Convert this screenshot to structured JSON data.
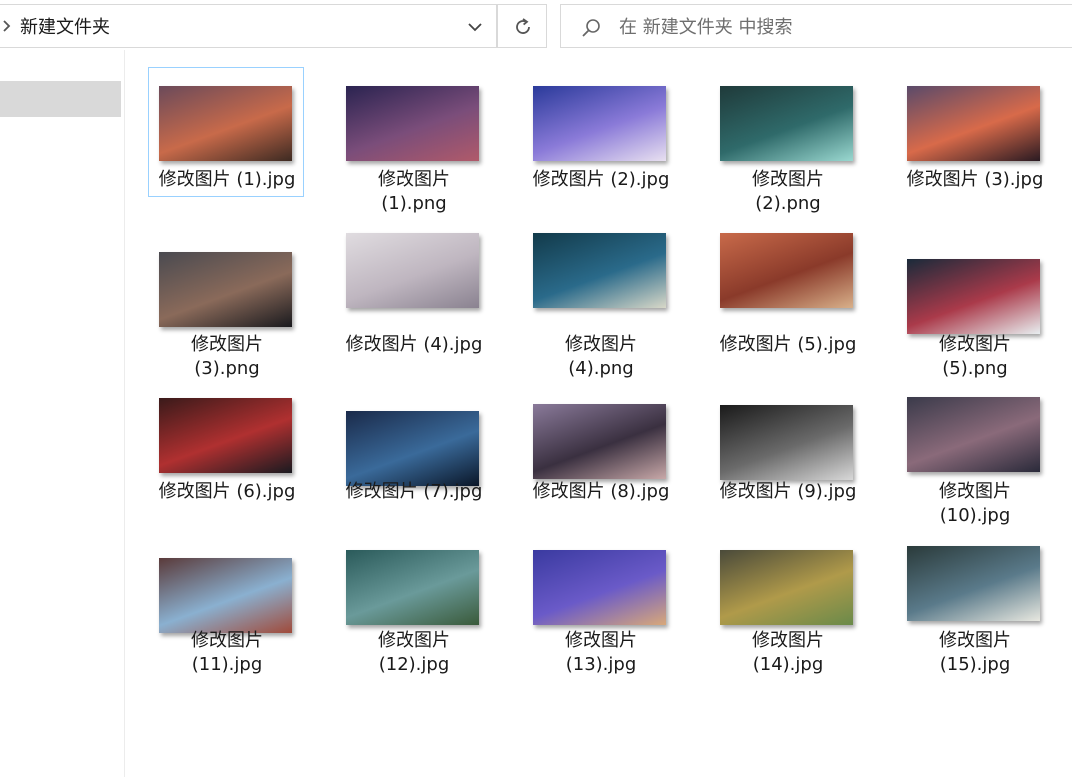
{
  "toolbar": {
    "address_text": "新建文件夹",
    "search_placeholder": "在 新建文件夹 中搜索"
  },
  "icons": {
    "address_chevron": "chevron-right-icon",
    "address_dropdown": "chevron-down-icon",
    "refresh": "refresh-icon",
    "search": "search-icon"
  },
  "files": [
    {
      "name": "修改图片 (1).jpg",
      "selected": true,
      "colors": [
        "#6b4a5a",
        "#c86a4a",
        "#3d2a22"
      ]
    },
    {
      "name": "修改图片\n(1).png",
      "selected": false,
      "colors": [
        "#2a2350",
        "#7a4d7a",
        "#b05a6a"
      ]
    },
    {
      "name": "修改图片 (2).jpg",
      "selected": false,
      "colors": [
        "#2a3a9a",
        "#8a7ad8",
        "#e8e0f0"
      ]
    },
    {
      "name": "修改图片\n(2).png",
      "selected": false,
      "colors": [
        "#1f3a3a",
        "#2f6a6a",
        "#9ad8d0"
      ]
    },
    {
      "name": "修改图片 (3).jpg",
      "selected": false,
      "colors": [
        "#5a4a6a",
        "#d86a4a",
        "#2a1a22"
      ]
    },
    {
      "name": "修改图片\n(3).png",
      "selected": false,
      "colors": [
        "#4a4a50",
        "#8a6a5a",
        "#1a1a1e"
      ]
    },
    {
      "name": "修改图片 (4).jpg",
      "selected": false,
      "colors": [
        "#e0dce0",
        "#bfb6c0",
        "#8a8290"
      ]
    },
    {
      "name": "修改图片\n(4).png",
      "selected": false,
      "colors": [
        "#123a4a",
        "#2a6a8a",
        "#d8d8c8"
      ]
    },
    {
      "name": "修改图片 (5).jpg",
      "selected": false,
      "colors": [
        "#c86a4a",
        "#8a3a2a",
        "#d8b08a"
      ]
    },
    {
      "name": "修改图片\n(5).png",
      "selected": false,
      "colors": [
        "#1a2a3a",
        "#aa3a4a",
        "#e8eef0"
      ]
    },
    {
      "name": "修改图片 (6).jpg",
      "selected": false,
      "colors": [
        "#3a1a1a",
        "#b03030",
        "#1a1a20"
      ]
    },
    {
      "name": "修改图片 (7).jpg",
      "selected": false,
      "colors": [
        "#1a2a4a",
        "#3a6a9a",
        "#0a1628"
      ]
    },
    {
      "name": "修改图片 (8).jpg",
      "selected": false,
      "colors": [
        "#8a7a9a",
        "#3a3040",
        "#c8a8a8"
      ]
    },
    {
      "name": "修改图片 (9).jpg",
      "selected": false,
      "colors": [
        "#1a1a1a",
        "#6a6a6a",
        "#d8d8d8"
      ]
    },
    {
      "name": "修改图片\n(10).jpg",
      "selected": false,
      "colors": [
        "#3a3a4a",
        "#8a6a7a",
        "#2a2a3a"
      ]
    },
    {
      "name": "修改图片\n(11).jpg",
      "selected": false,
      "colors": [
        "#5a3a3a",
        "#8ab0d0",
        "#a04a3a"
      ]
    },
    {
      "name": "修改图片\n(12).jpg",
      "selected": false,
      "colors": [
        "#2a5a5a",
        "#6a9a9a",
        "#3a5a3a"
      ]
    },
    {
      "name": "修改图片\n(13).jpg",
      "selected": false,
      "colors": [
        "#3a3aa0",
        "#6a5ac8",
        "#d8a87a"
      ]
    },
    {
      "name": "修改图片\n(14).jpg",
      "selected": false,
      "colors": [
        "#4a4a3a",
        "#b09a4a",
        "#6a8a4a"
      ]
    },
    {
      "name": "修改图片\n(15).jpg",
      "selected": false,
      "colors": [
        "#2a3a3a",
        "#5a7a8a",
        "#e8e8e0"
      ]
    }
  ]
}
